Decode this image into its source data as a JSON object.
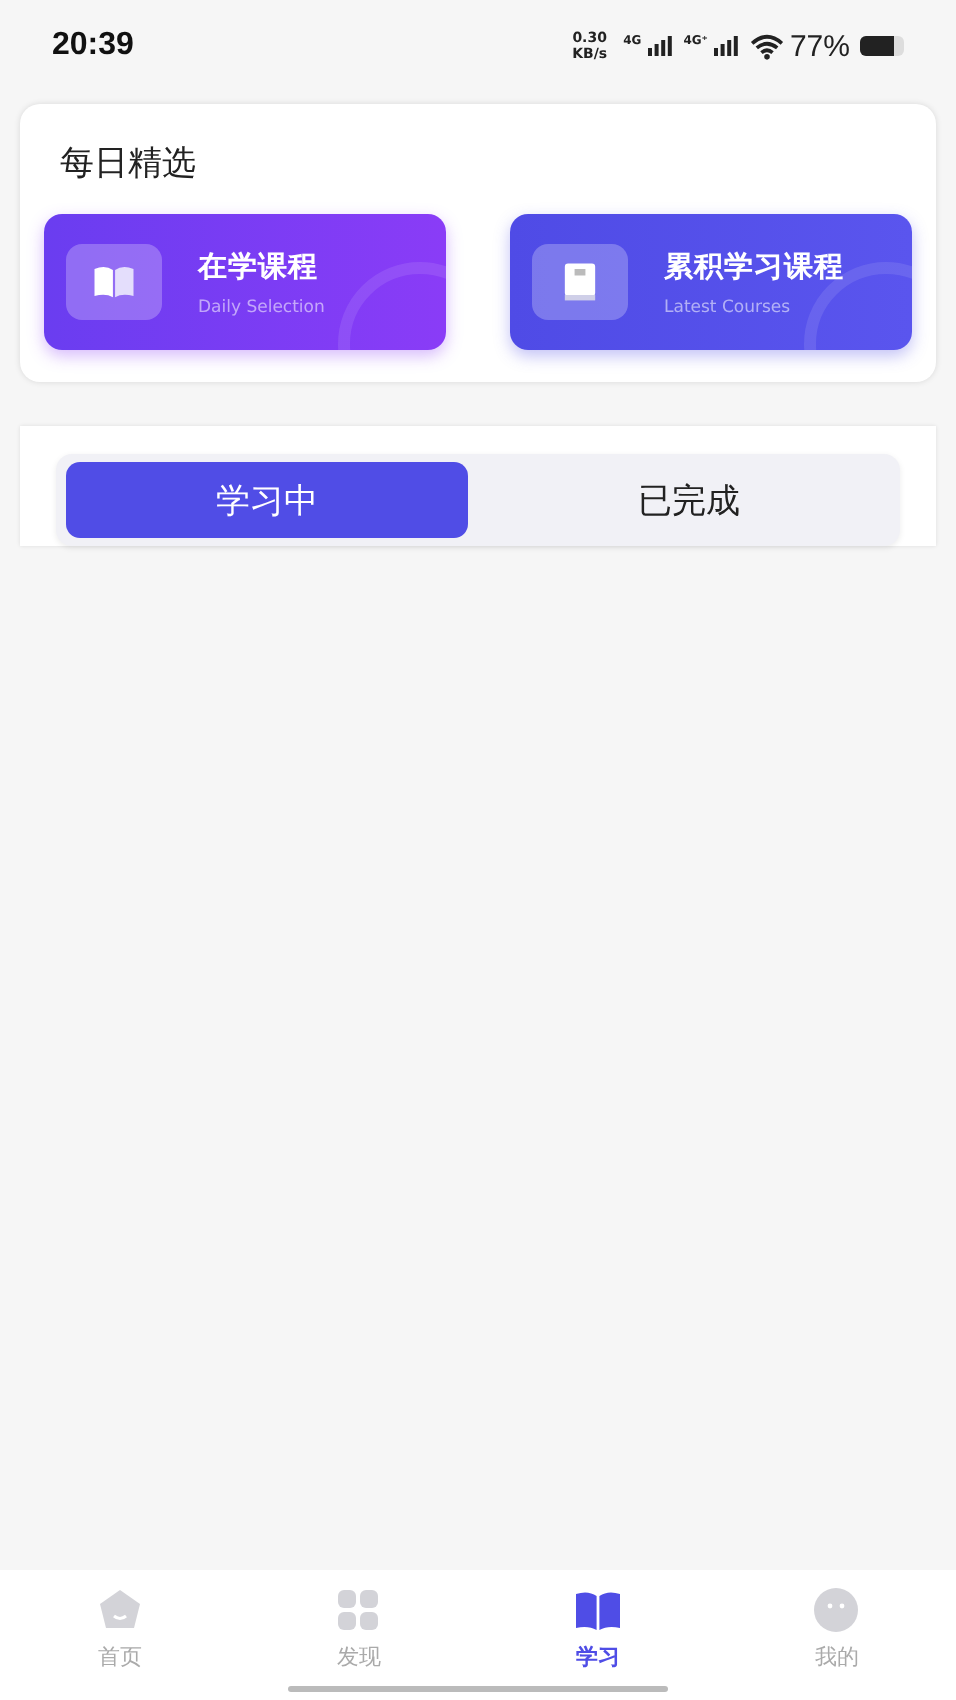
{
  "status_bar": {
    "time": "20:39",
    "speed_value": "0.30",
    "speed_unit": "KB/s",
    "sim_labels": [
      "4G",
      "4G⁺"
    ],
    "battery": "77%"
  },
  "daily": {
    "title": "每日精选",
    "courses": [
      {
        "title": "在学课程",
        "subtitle": "Daily Selection",
        "kind": "open-book"
      },
      {
        "title": "累积学习课程",
        "subtitle": "Latest Courses",
        "kind": "closed-book"
      }
    ]
  },
  "tabs": [
    {
      "label": "学习中",
      "selected": true
    },
    {
      "label": "已完成",
      "selected": false
    }
  ],
  "nav": [
    {
      "label": "首页",
      "kind": "home",
      "selected": false
    },
    {
      "label": "发现",
      "kind": "grid",
      "selected": false
    },
    {
      "label": "学习",
      "kind": "book",
      "selected": true
    },
    {
      "label": "我的",
      "kind": "face",
      "selected": false
    }
  ]
}
